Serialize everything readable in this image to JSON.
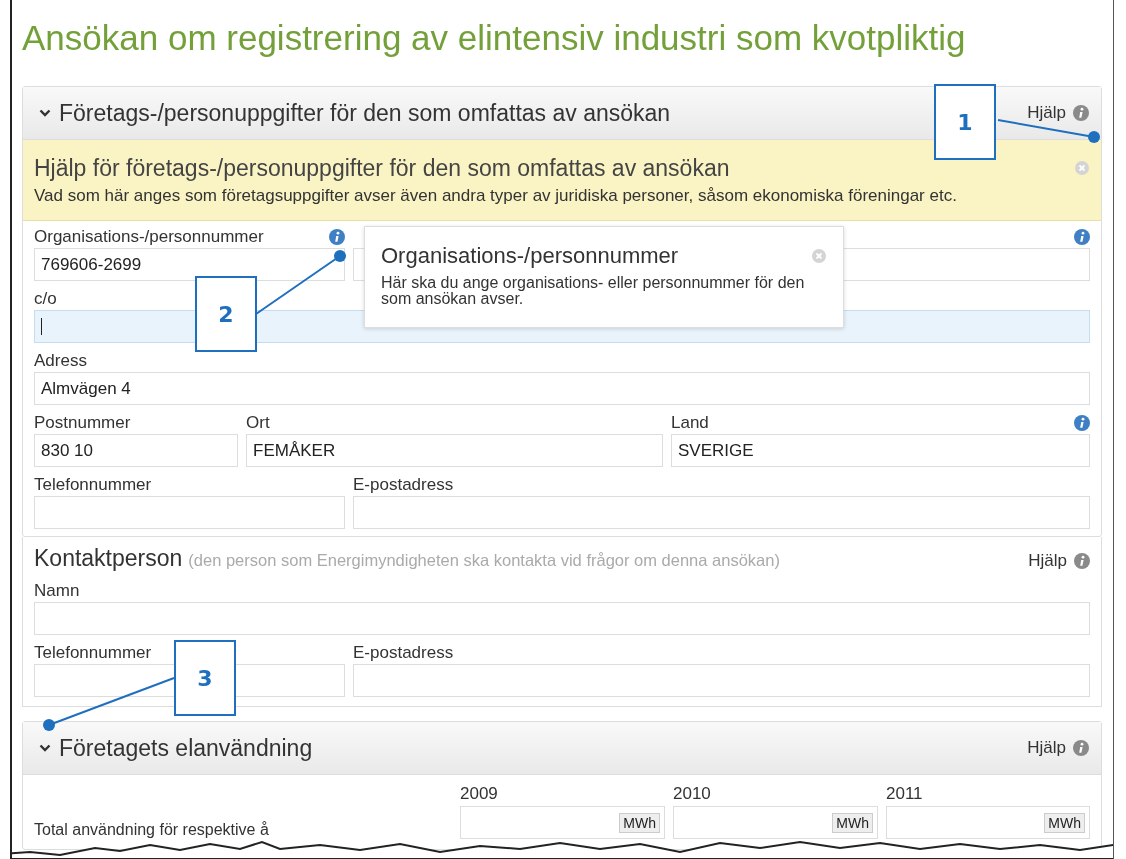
{
  "title": "Ansökan om registrering av elintensiv industri som kvotpliktig",
  "company_section": {
    "heading": "Företags-/personuppgifter för den som omfattas av ansökan",
    "expanded": true,
    "help_link": "Hjälp",
    "help_panel": {
      "title": "Hjälp för företags-/personuppgifter för den som omfattas av ansökan",
      "text": "Vad som här anges som företagsuppgifter avser även andra typer av juridiska personer, såsom ekonomiska föreningar etc."
    },
    "rows": [
      [
        {
          "label": "Organisations-/personnummer",
          "value": "769606-2699",
          "info": true,
          "focused": false
        },
        {
          "info": true,
          "focused": false
        }
      ],
      [
        {
          "label": "c/o",
          "info": false,
          "focused": true
        }
      ],
      [
        {
          "label": "Adress",
          "value": "Almvägen 4",
          "info": false,
          "focused": false
        }
      ],
      [
        {
          "label": "Postnummer",
          "value": "830 10",
          "info": false,
          "focused": false
        },
        {
          "label": "Ort",
          "value": "FEMÅKER",
          "info": false,
          "focused": false
        },
        {
          "label": "Land",
          "value": "SVERIGE",
          "info": true,
          "focused": false
        }
      ],
      [
        {
          "label": "Telefonnummer",
          "info": false,
          "focused": false
        },
        {
          "label": "E-postadress",
          "info": false,
          "focused": false
        }
      ]
    ]
  },
  "tooltip": {
    "title": "Organisations-/personnummer",
    "text": "Här ska du ange organisations- eller personnummer för den som ansökan avser."
  },
  "contact_section": {
    "heading": "Kontaktperson",
    "note": "(den person som Energimyndigheten ska kontakta vid frågor om denna ansökan)",
    "help_link": "Hjälp",
    "rows": [
      [
        {
          "label": "Namn",
          "info": false,
          "focused": false
        }
      ],
      [
        {
          "label": "Telefonnummer",
          "info": false,
          "focused": false
        },
        {
          "label": "E-postadress",
          "info": false,
          "focused": false
        }
      ]
    ]
  },
  "usage_section": {
    "heading": "Företagets elanvändning",
    "expanded": true,
    "help_link": "Hjälp",
    "row_label": "Total användning för respektive å",
    "years": [
      {
        "label": "2009",
        "unit": "MWh"
      },
      {
        "label": "2010",
        "unit": "MWh"
      },
      {
        "label": "2011",
        "unit": "MWh"
      }
    ]
  },
  "callouts": [
    {
      "number": "1"
    },
    {
      "number": "2"
    },
    {
      "number": "3"
    }
  ]
}
